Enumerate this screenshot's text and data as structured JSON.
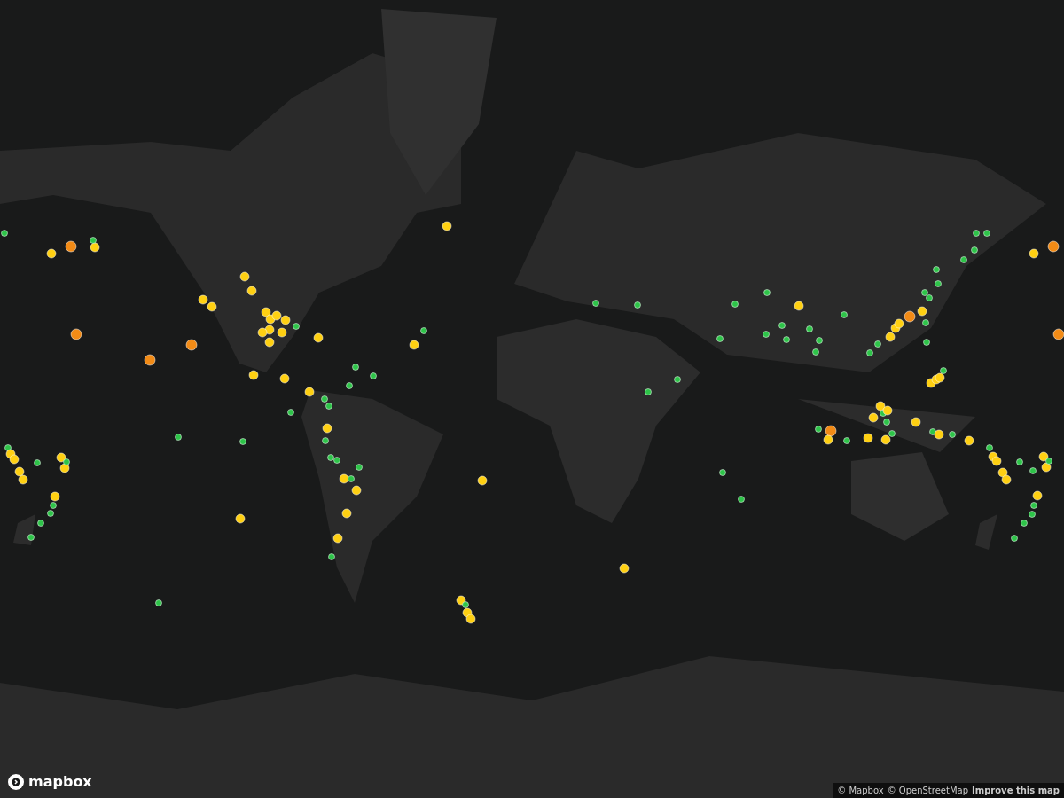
{
  "logo": {
    "text": "mapbox"
  },
  "attribution": [
    {
      "text": "© Mapbox",
      "kind": "link"
    },
    {
      "text": "© OpenStreetMap",
      "kind": "link"
    },
    {
      "text": "Improve this map",
      "kind": "strong-link"
    }
  ]
}
